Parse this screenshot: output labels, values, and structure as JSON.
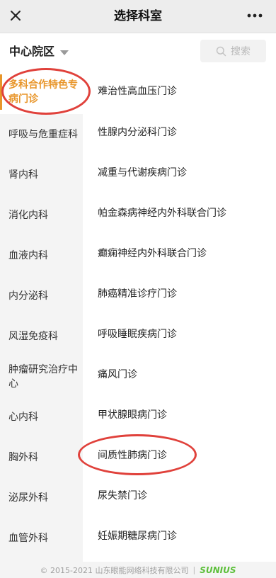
{
  "topbar": {
    "title": "选择科室",
    "close_icon": "close-icon",
    "more_icon": "more-icon"
  },
  "header": {
    "campus": "中心院区",
    "search_label": "搜索"
  },
  "sidebar": {
    "items": [
      {
        "label": "多科合作特色专病门诊"
      },
      {
        "label": "呼吸与危重症科"
      },
      {
        "label": "肾内科"
      },
      {
        "label": "消化内科"
      },
      {
        "label": "血液内科"
      },
      {
        "label": "内分泌科"
      },
      {
        "label": "风湿免疫科"
      },
      {
        "label": "肿瘤研究治疗中心"
      },
      {
        "label": "心内科"
      },
      {
        "label": "胸外科"
      },
      {
        "label": "泌尿外科"
      },
      {
        "label": "血管外科"
      }
    ]
  },
  "list": {
    "items": [
      {
        "label": "难治性高血压门诊"
      },
      {
        "label": "性腺内分泌科门诊"
      },
      {
        "label": "减重与代谢疾病门诊"
      },
      {
        "label": "帕金森病神经内外科联合门诊"
      },
      {
        "label": "癫痫神经内外科联合门诊"
      },
      {
        "label": "肺癌精准诊疗门诊"
      },
      {
        "label": "呼吸睡眠疾病门诊"
      },
      {
        "label": "痛风门诊"
      },
      {
        "label": "甲状腺眼病门诊"
      },
      {
        "label": "间质性肺病门诊"
      },
      {
        "label": "尿失禁门诊"
      },
      {
        "label": "妊娠期糖尿病门诊"
      }
    ]
  },
  "footer": {
    "copyright": "© 2015-2021 山东眼能网络科技有限公司",
    "separator": "|",
    "brand": "SUNIUS"
  },
  "colors": {
    "accent": "#e8962b",
    "annotation": "#e0413b",
    "brand": "#5cbf3a"
  }
}
